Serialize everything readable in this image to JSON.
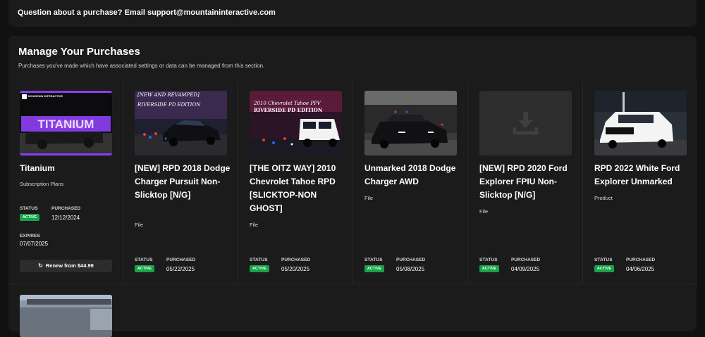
{
  "banner": {
    "text": "Question about a purchase? Email support@mountaininteractive.com"
  },
  "section": {
    "title": "Manage Your Purchases",
    "subtitle": "Purchases you've made which have associated settings or data can be managed from this section."
  },
  "labels": {
    "status": "STATUS",
    "purchased": "PURCHASED",
    "expires": "EXPIRES",
    "active": "ACTIVE"
  },
  "cards": [
    {
      "title": "Titanium",
      "type": "Subscription Plans",
      "purchased": "12/12/2024",
      "expires": "07/07/2025",
      "renew": "Renew from $44.99",
      "thumb_text": "TITANIUM",
      "logo_text": "MOUNTAIN INTERACTIVE"
    },
    {
      "title": "[NEW] RPD 2018 Dodge Charger Pursuit Non-Slicktop [N/G]",
      "type": "File",
      "purchased": "05/22/2025",
      "thumb_text": "RIVERSIDE PD EDITION"
    },
    {
      "title": "[THE OITZ WAY] 2010 Chevrolet Tahoe RPD [SLICKTOP-NON GHOST]",
      "type": "File",
      "purchased": "05/20/2025",
      "thumb_text": "RIVERSIDE PD EDITION"
    },
    {
      "title": "Unmarked 2018 Dodge Charger AWD",
      "type": "File",
      "purchased": "05/08/2025"
    },
    {
      "title": "[NEW] RPD 2020 Ford Explorer FPIU Non-Slicktop [N/G]",
      "type": "File",
      "purchased": "04/09/2025"
    },
    {
      "title": "RPD 2022 White Ford Explorer Unmarked",
      "type": "Product",
      "purchased": "04/06/2025"
    }
  ],
  "colors": {
    "background": "#111111",
    "panel": "#1b1b1b",
    "active_badge": "#17a34a",
    "titanium_purple": "#8b3ff0"
  }
}
